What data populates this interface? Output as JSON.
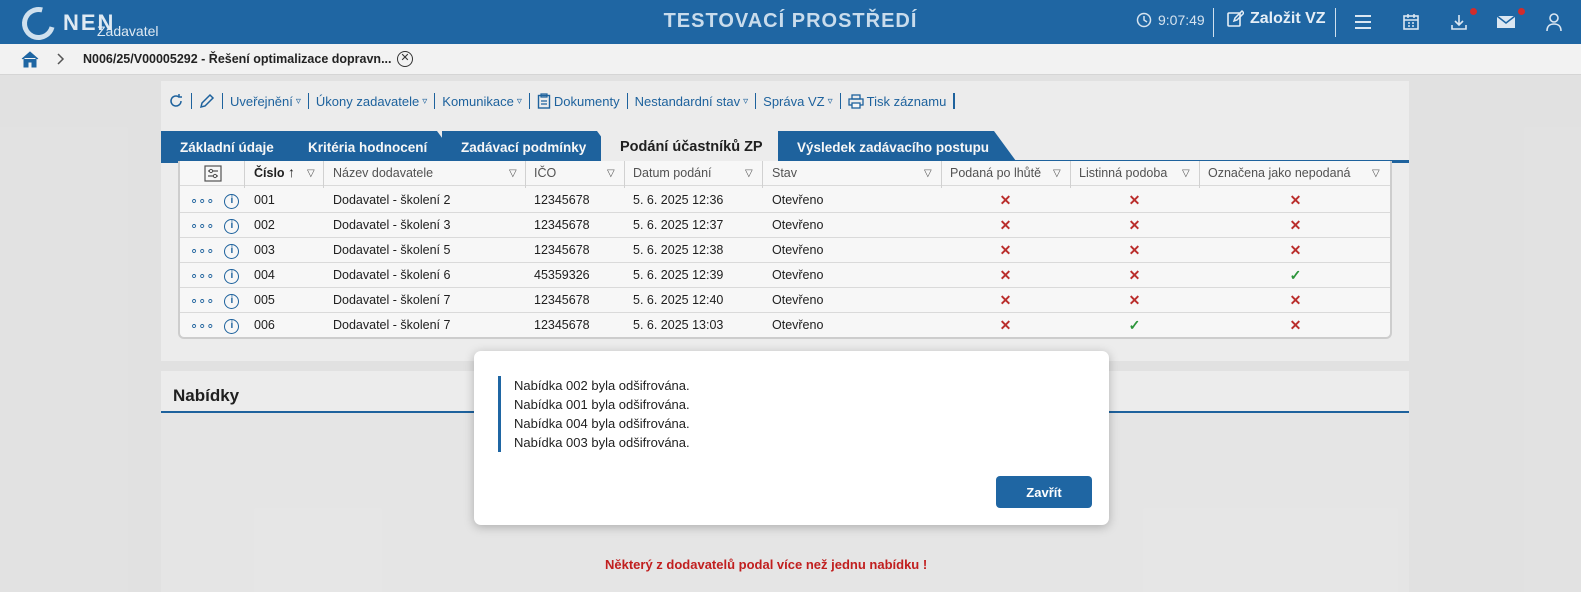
{
  "header": {
    "logo_text": "NEN",
    "logo_sub": "Zadavatel",
    "env_title": "TESTOVACÍ PROSTŘEDÍ",
    "clock": "9:07:49",
    "create_label": "Založit VZ"
  },
  "breadcrumb": {
    "title": "N006/25/V00005292 - Řešení optimalizace dopravn..."
  },
  "toolbar": {
    "items": [
      "Uveřejnění",
      "Úkony zadavatele",
      "Komunikace",
      "Dokumenty",
      "Nestandardní stav",
      "Správa VZ",
      "Tisk záznamu"
    ]
  },
  "tabs": [
    "Základní údaje",
    "Kritéria hodnocení",
    "Zadávací podmínky",
    "Podání účastníků ZP",
    "Výsledek zadávacího postupu"
  ],
  "table": {
    "columns": [
      "Číslo",
      "Název dodavatele",
      "IČO",
      "Datum podání",
      "Stav",
      "Podaná po lhůtě",
      "Listinná podoba",
      "Označena jako nepodaná"
    ],
    "rows": [
      {
        "cislo": "001",
        "nazev": "Dodavatel - školení 2",
        "ico": "12345678",
        "datum": "5. 6. 2025 12:36",
        "stav": "Otevřeno",
        "po_lhute": "✕",
        "listinna": "✕",
        "nepodana": "✕"
      },
      {
        "cislo": "002",
        "nazev": "Dodavatel - školení 3",
        "ico": "12345678",
        "datum": "5. 6. 2025 12:37",
        "stav": "Otevřeno",
        "po_lhute": "✕",
        "listinna": "✕",
        "nepodana": "✕"
      },
      {
        "cislo": "003",
        "nazev": "Dodavatel - školení 5",
        "ico": "12345678",
        "datum": "5. 6. 2025 12:38",
        "stav": "Otevřeno",
        "po_lhute": "✕",
        "listinna": "✕",
        "nepodana": "✕"
      },
      {
        "cislo": "004",
        "nazev": "Dodavatel - školení 6",
        "ico": "45359326",
        "datum": "5. 6. 2025 12:39",
        "stav": "Otevřeno",
        "po_lhute": "✕",
        "listinna": "✕",
        "nepodana": "✓"
      },
      {
        "cislo": "005",
        "nazev": "Dodavatel - školení 7",
        "ico": "12345678",
        "datum": "5. 6. 2025 12:40",
        "stav": "Otevřeno",
        "po_lhute": "✕",
        "listinna": "✕",
        "nepodana": "✕"
      },
      {
        "cislo": "006",
        "nazev": "Dodavatel - školení 7",
        "ico": "12345678",
        "datum": "5. 6. 2025 13:03",
        "stav": "Otevřeno",
        "po_lhute": "✕",
        "listinna": "✓",
        "nepodana": "✕"
      }
    ]
  },
  "lower": {
    "title": "Nabídky",
    "warning": "Některý z dodavatelů podal více než jednu nabídku !"
  },
  "modal": {
    "messages": [
      "Nabídka 002 byla odšifrována.",
      "Nabídka 001 byla odšifrována.",
      "Nabídka 004 byla odšifrována.",
      "Nabídka 003 byla odšifrována."
    ],
    "close_label": "Zavřít"
  },
  "colors": {
    "brand": "#1f66a3",
    "error": "#c0302e",
    "success": "#2e9a3c"
  }
}
